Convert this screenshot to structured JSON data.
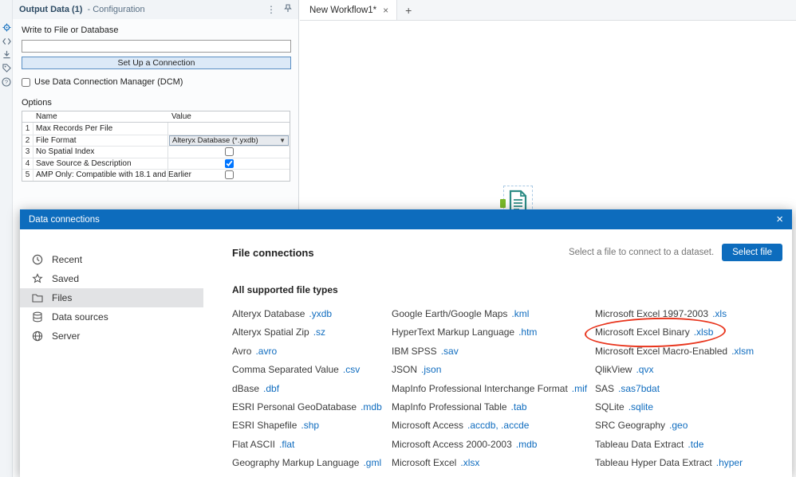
{
  "colors": {
    "header_blue": "#0d6cbd",
    "link_blue": "#0f6cbf",
    "highlight_red": "#e8341c",
    "anchor_green": "#79b928",
    "tool_teal": "#2d8c85",
    "setup_btn_bg": "#dce9f7"
  },
  "config_panel": {
    "title": "Output Data (1)",
    "subtitle": "- Configuration",
    "write_label": "Write to File or Database",
    "connection_input_value": "",
    "setup_button": "Set Up a Connection",
    "dcm_checkbox_label": "Use Data Connection Manager (DCM)",
    "dcm_checked": false,
    "options_label": "Options",
    "table": {
      "headers": [
        "Name",
        "Value"
      ],
      "rows": [
        {
          "num": "1",
          "name": "Max Records Per File",
          "value_type": "empty",
          "value": ""
        },
        {
          "num": "2",
          "name": "File Format",
          "value_type": "select",
          "value": "Alteryx Database (*.yxdb)"
        },
        {
          "num": "3",
          "name": "No Spatial Index",
          "value_type": "checkbox",
          "checked": false
        },
        {
          "num": "4",
          "name": "Save Source & Description",
          "value_type": "checkbox",
          "checked": true
        },
        {
          "num": "5",
          "name": "AMP Only: Compatible with 18.1 and Earlier",
          "value_type": "checkbox",
          "checked": false
        }
      ]
    }
  },
  "canvas": {
    "tab_label": "New Workflow1*",
    "tab_close": "×",
    "new_tab": "+",
    "tool_name": "Output Data tool"
  },
  "modal": {
    "title": "Data connections",
    "close": "×",
    "sidebar": [
      {
        "label": "Recent"
      },
      {
        "label": "Saved"
      },
      {
        "label": "Files",
        "selected": true
      },
      {
        "label": "Data sources"
      },
      {
        "label": "Server"
      }
    ],
    "heading": "File connections",
    "select_hint": "Select a file to connect to a dataset.",
    "select_button": "Select file",
    "section_title": "All supported file types",
    "file_type_columns": [
      [
        {
          "name": "Alteryx Database",
          "ext": ".yxdb"
        },
        {
          "name": "Alteryx Spatial Zip",
          "ext": ".sz"
        },
        {
          "name": "Avro",
          "ext": ".avro"
        },
        {
          "name": "Comma Separated Value",
          "ext": ".csv"
        },
        {
          "name": "dBase",
          "ext": ".dbf"
        },
        {
          "name": "ESRI Personal GeoDatabase",
          "ext": ".mdb"
        },
        {
          "name": "ESRI Shapefile",
          "ext": ".shp"
        },
        {
          "name": "Flat ASCII",
          "ext": ".flat"
        },
        {
          "name": "Geography Markup Language",
          "ext": ".gml"
        }
      ],
      [
        {
          "name": "Google Earth/Google Maps",
          "ext": ".kml"
        },
        {
          "name": "HyperText Markup Language",
          "ext": ".htm"
        },
        {
          "name": "IBM SPSS",
          "ext": ".sav"
        },
        {
          "name": "JSON",
          "ext": ".json"
        },
        {
          "name": "MapInfo Professional Interchange Format",
          "ext": ".mif"
        },
        {
          "name": "MapInfo Professional Table",
          "ext": ".tab"
        },
        {
          "name": "Microsoft Access",
          "ext": ".accdb, .accde"
        },
        {
          "name": "Microsoft Access 2000-2003",
          "ext": ".mdb"
        },
        {
          "name": "Microsoft Excel",
          "ext": ".xlsx"
        }
      ],
      [
        {
          "name": "Microsoft Excel 1997-2003",
          "ext": ".xls"
        },
        {
          "name": "Microsoft Excel Binary",
          "ext": ".xlsb",
          "highlighted": true
        },
        {
          "name": "Microsoft Excel Macro-Enabled",
          "ext": ".xlsm"
        },
        {
          "name": "QlikView",
          "ext": ".qvx"
        },
        {
          "name": "SAS",
          "ext": ".sas7bdat"
        },
        {
          "name": "SQLite",
          "ext": ".sqlite"
        },
        {
          "name": "SRC Geography",
          "ext": ".geo"
        },
        {
          "name": "Tableau Data Extract",
          "ext": ".tde"
        },
        {
          "name": "Tableau Hyper Data Extract",
          "ext": ".hyper"
        }
      ]
    ]
  }
}
